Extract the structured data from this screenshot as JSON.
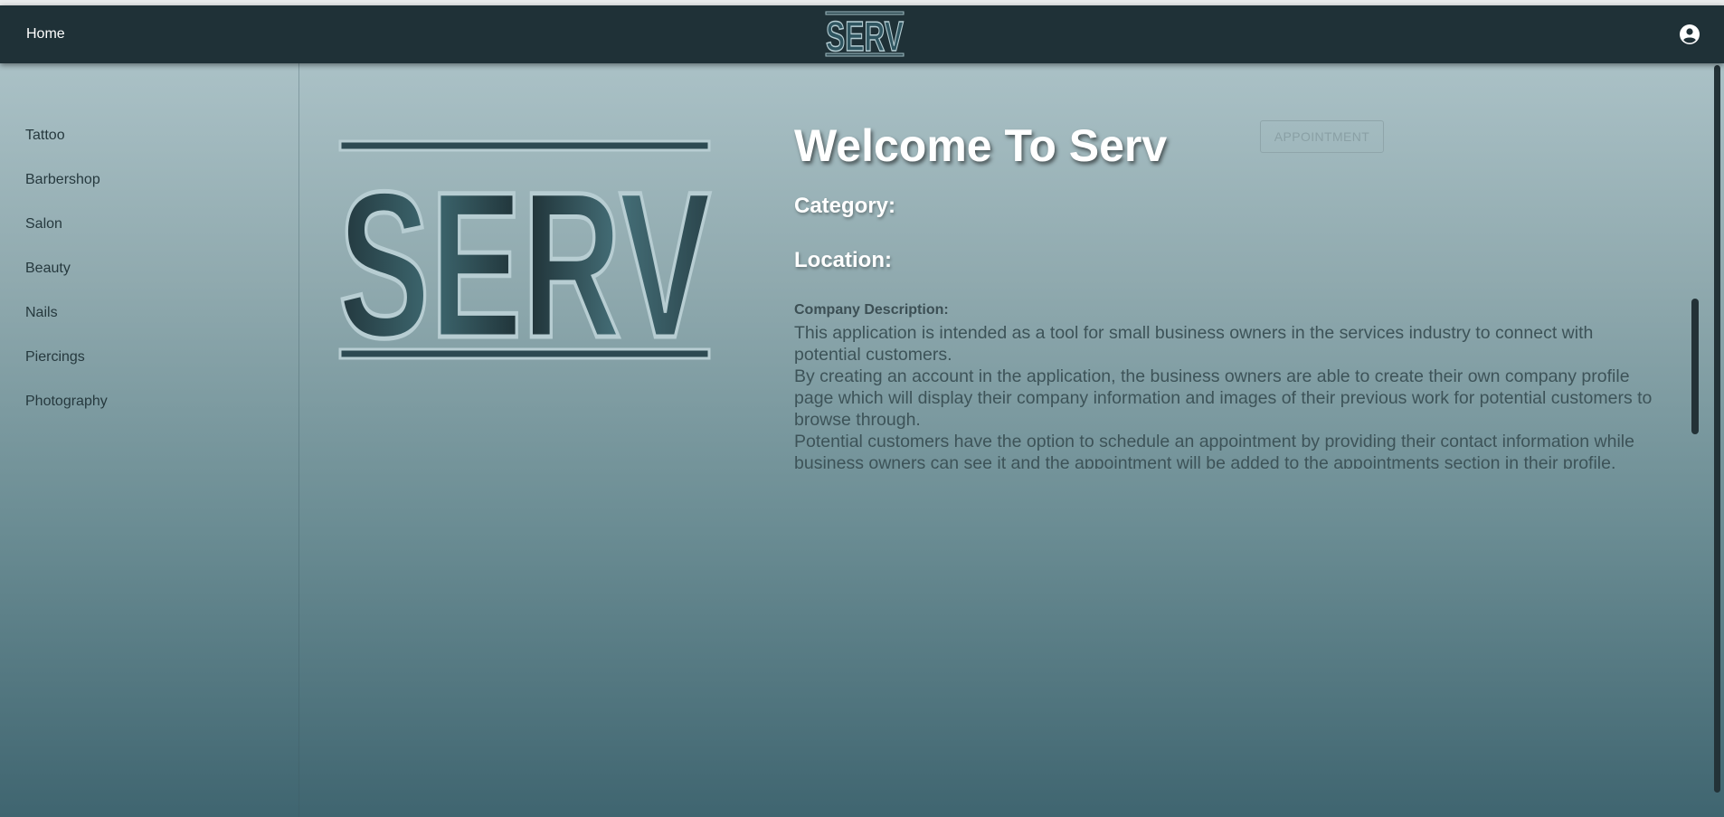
{
  "appbar": {
    "home_label": "Home",
    "logo_text": "SERV",
    "account_icon": "account-circle-icon"
  },
  "sidebar": {
    "items": [
      {
        "label": "Tattoo"
      },
      {
        "label": "Barbershop"
      },
      {
        "label": "Salon"
      },
      {
        "label": "Beauty"
      },
      {
        "label": "Nails"
      },
      {
        "label": "Piercings"
      },
      {
        "label": "Photography"
      }
    ]
  },
  "main": {
    "logo_text": "SERV",
    "title": "Welcome To Serv",
    "appointment_button": "APPOINTMENT",
    "category_label": "Category:",
    "location_label": "Location:",
    "description_label": "Company Description:",
    "description_lines": [
      "This application is intended as a tool for small business owners in the services industry to connect with",
      "potential customers.",
      "By creating an account in the application, the business owners are able to create their own company profile",
      "page which will display their company information and images of their previous work for potential customers to",
      "browse through.",
      "Potential customers have the option to schedule an appointment by providing their contact information while",
      "business owners can see it and the appointment will be added to the appointments section in their profile."
    ]
  },
  "colors": {
    "appbar_bg": "#1f3137",
    "gradient_top": "#b2c8cd",
    "gradient_bottom": "#3f6570",
    "logo_dark": "#22373d",
    "logo_teal": "#41676f",
    "logo_outline": "#b7cdd2"
  }
}
